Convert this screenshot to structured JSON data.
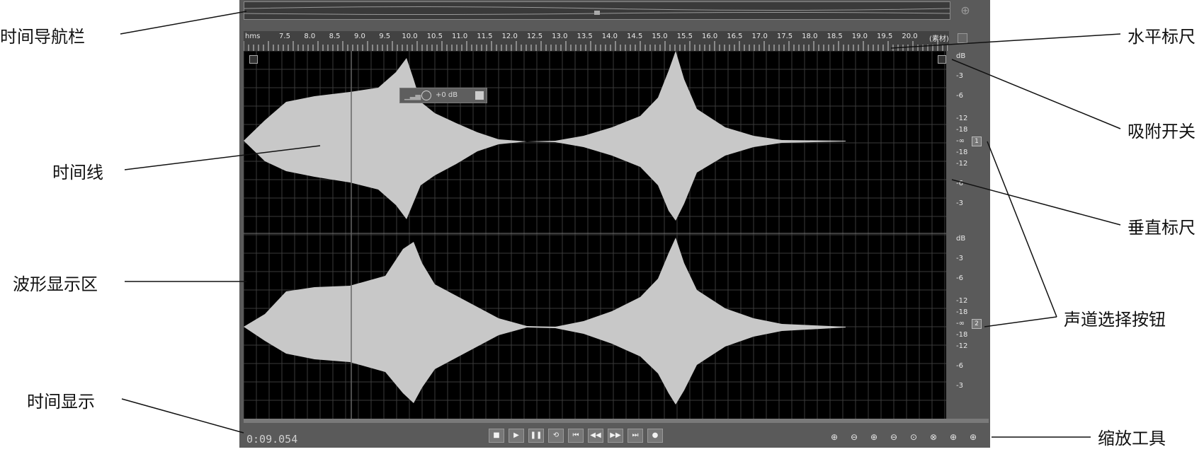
{
  "ruler": {
    "units_label": "hms",
    "source_label": "(素材)",
    "ticks": [
      "7.5",
      "8.0",
      "8.5",
      "9.0",
      "9.5",
      "10.0",
      "10.5",
      "11.0",
      "11.5",
      "12.0",
      "12.5",
      "13.0",
      "13.5",
      "14.0",
      "14.5",
      "15.0",
      "15.5",
      "16.0",
      "16.5",
      "17.0",
      "17.5",
      "18.0",
      "18.5",
      "19.0",
      "19.5",
      "20.0"
    ]
  },
  "vertical_ruler": {
    "channel1": [
      "dB",
      "-3",
      "-6",
      "-12",
      "-18",
      "-∞",
      "-18",
      "-12",
      "-6",
      "-3"
    ],
    "channel2": [
      "dB",
      "-3",
      "-6",
      "-12",
      "-18",
      "-∞",
      "-18",
      "-12",
      "-6",
      "-3"
    ],
    "channel_buttons": [
      "1",
      "2"
    ]
  },
  "hud": {
    "value": "+0 dB"
  },
  "time_display": "0:09.054",
  "transport": {
    "stop": "■",
    "play": "▶",
    "pause": "❚❚",
    "loop": "⟲",
    "to_start": "⏮",
    "rewind": "◀◀",
    "fast_forward": "▶▶",
    "to_end": "⏭",
    "record": "●"
  },
  "zoom_tools": [
    "zoom-in-amplitude",
    "zoom-out-amplitude",
    "zoom-in-time",
    "zoom-out-time",
    "zoom-full",
    "zoom-selection",
    "zoom-in-point-left",
    "zoom-in-point-right",
    "zoom-to-selection"
  ],
  "callouts": {
    "time_navigator": "时间导航栏",
    "horizontal_ruler": "水平标尺",
    "snap_toggle": "吸附开关",
    "time_line": "时间线",
    "vertical_ruler": "垂直标尺",
    "waveform_area": "波形显示区",
    "channel_select": "声道选择按钮",
    "time_display": "时间显示",
    "zoom_tools": "缩放工具"
  },
  "colors": {
    "waveform": "#c8c8c8",
    "background": "#000000",
    "panel": "#5a5a5a"
  }
}
